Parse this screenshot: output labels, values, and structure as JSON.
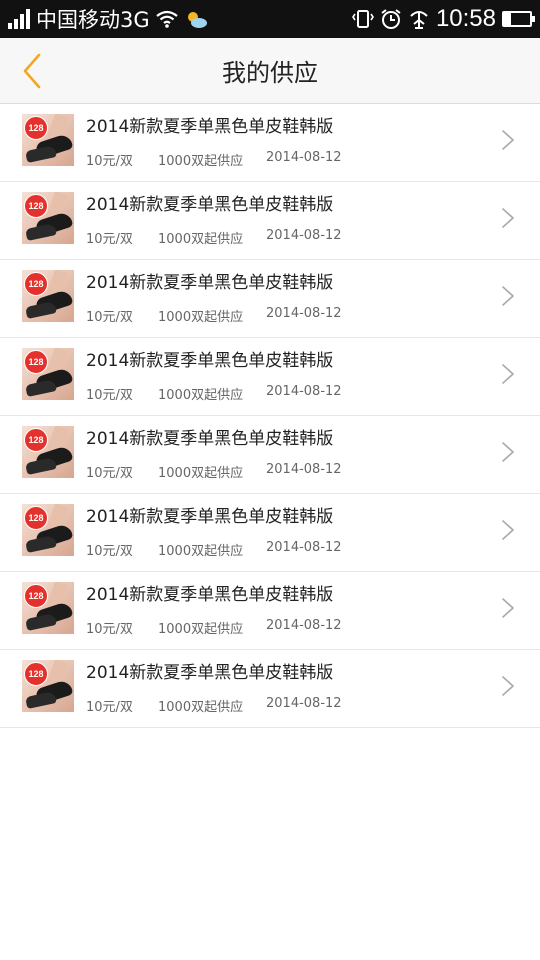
{
  "status_bar": {
    "carrier": "中国移动3G",
    "time": "10:58",
    "icons": [
      "signal-icon",
      "wifi-icon",
      "weather-icon",
      "vibrate-icon",
      "alarm-icon",
      "usb-icon",
      "battery-icon"
    ]
  },
  "header": {
    "title": "我的供应",
    "back_icon": "chevron-left-icon",
    "accent_color": "#f5a623"
  },
  "thumb_badge": "128",
  "items": [
    {
      "title": "2014新款夏季单黑色单皮鞋韩版",
      "price": "10元/双",
      "quantity": "1000双起供应",
      "date": "2014-08-12"
    },
    {
      "title": "2014新款夏季单黑色单皮鞋韩版",
      "price": "10元/双",
      "quantity": "1000双起供应",
      "date": "2014-08-12"
    },
    {
      "title": "2014新款夏季单黑色单皮鞋韩版",
      "price": "10元/双",
      "quantity": "1000双起供应",
      "date": "2014-08-12"
    },
    {
      "title": "2014新款夏季单黑色单皮鞋韩版",
      "price": "10元/双",
      "quantity": "1000双起供应",
      "date": "2014-08-12"
    },
    {
      "title": "2014新款夏季单黑色单皮鞋韩版",
      "price": "10元/双",
      "quantity": "1000双起供应",
      "date": "2014-08-12"
    },
    {
      "title": "2014新款夏季单黑色单皮鞋韩版",
      "price": "10元/双",
      "quantity": "1000双起供应",
      "date": "2014-08-12"
    },
    {
      "title": "2014新款夏季单黑色单皮鞋韩版",
      "price": "10元/双",
      "quantity": "1000双起供应",
      "date": "2014-08-12"
    },
    {
      "title": "2014新款夏季单黑色单皮鞋韩版",
      "price": "10元/双",
      "quantity": "1000双起供应",
      "date": "2014-08-12"
    }
  ]
}
